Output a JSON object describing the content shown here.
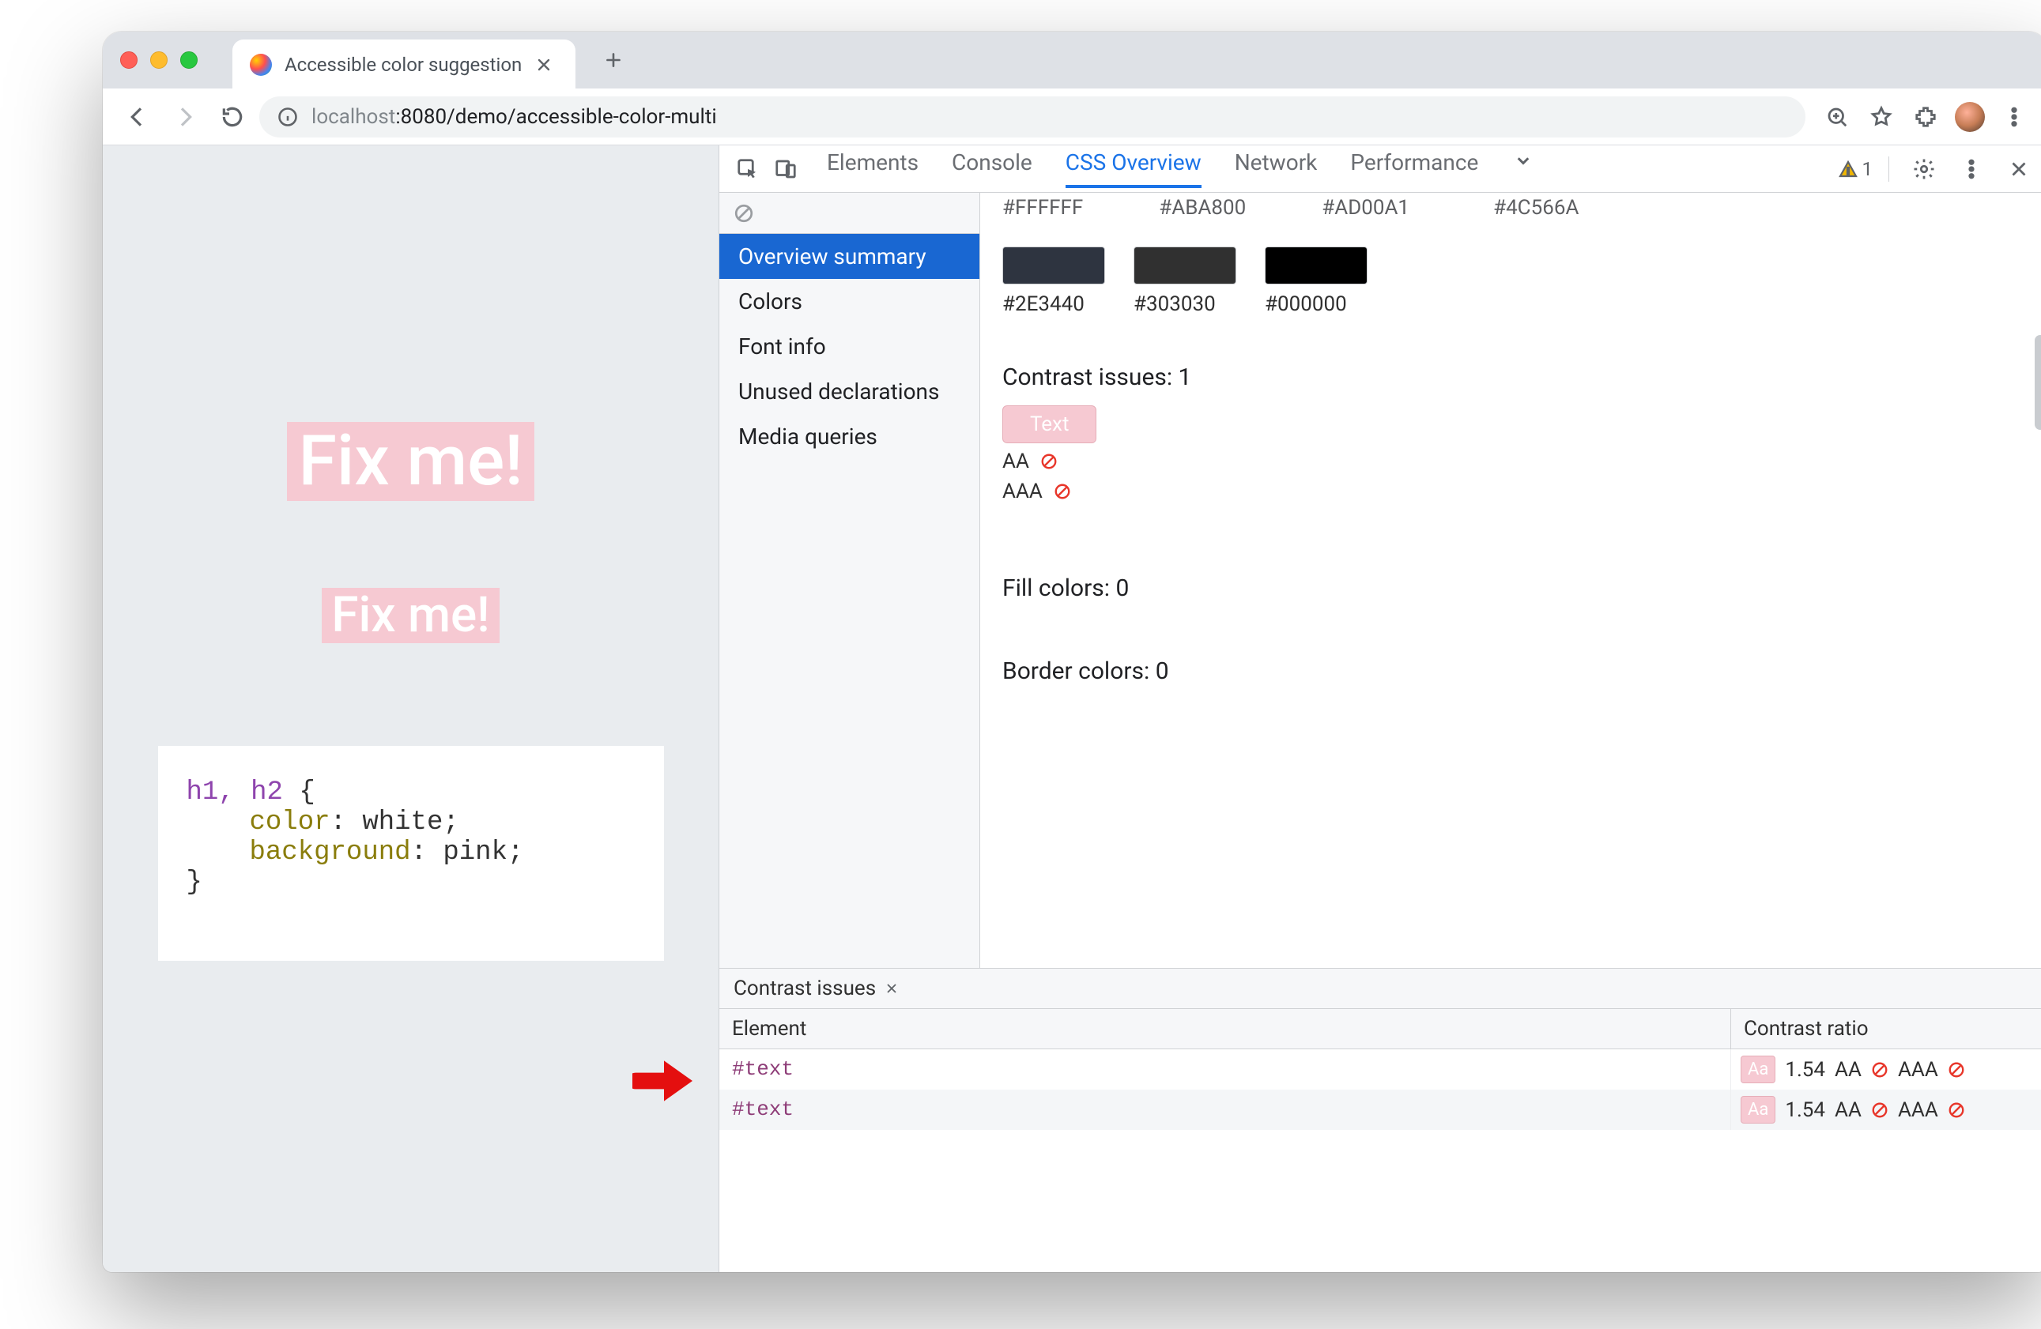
{
  "tab": {
    "title": "Accessible color suggestion"
  },
  "url": {
    "host_faded": "localhost",
    "port_path": ":8080/demo/accessible-color-multi"
  },
  "page": {
    "h1": "Fix me!",
    "h2": "Fix me!",
    "code": {
      "selector": "h1, h2",
      "open": "{",
      "prop1": "color",
      "val1": "white",
      "prop2": "background",
      "val2": "pink",
      "close": "}"
    }
  },
  "devtools": {
    "tabs": [
      "Elements",
      "Console",
      "CSS Overview",
      "Network",
      "Performance"
    ],
    "active_tab": "CSS Overview",
    "warn_count": "1",
    "side": {
      "items": [
        "Overview summary",
        "Colors",
        "Font info",
        "Unused declarations",
        "Media queries"
      ],
      "active": "Overview summary"
    },
    "cut_labels": [
      "#FFFFFF",
      "#ABA800",
      "#AD00A1",
      "#4C566A"
    ],
    "swatches": [
      {
        "hex": "#2E3440"
      },
      {
        "hex": "#303030"
      },
      {
        "hex": "#000000"
      }
    ],
    "contrast_issues_label": "Contrast issues: 1",
    "contrast_badge": "Text",
    "aa_label": "AA",
    "aaa_label": "AAA",
    "fill_label": "Fill colors: 0",
    "border_label": "Border colors: 0",
    "lower": {
      "tab": "Contrast issues",
      "col_element": "Element",
      "col_ratio": "Contrast ratio",
      "rows": [
        {
          "el": "#text",
          "pill": "Aa",
          "ratio": "1.54",
          "aa": "AA",
          "aaa": "AAA"
        },
        {
          "el": "#text",
          "pill": "Aa",
          "ratio": "1.54",
          "aa": "AA",
          "aaa": "AAA"
        }
      ]
    }
  }
}
